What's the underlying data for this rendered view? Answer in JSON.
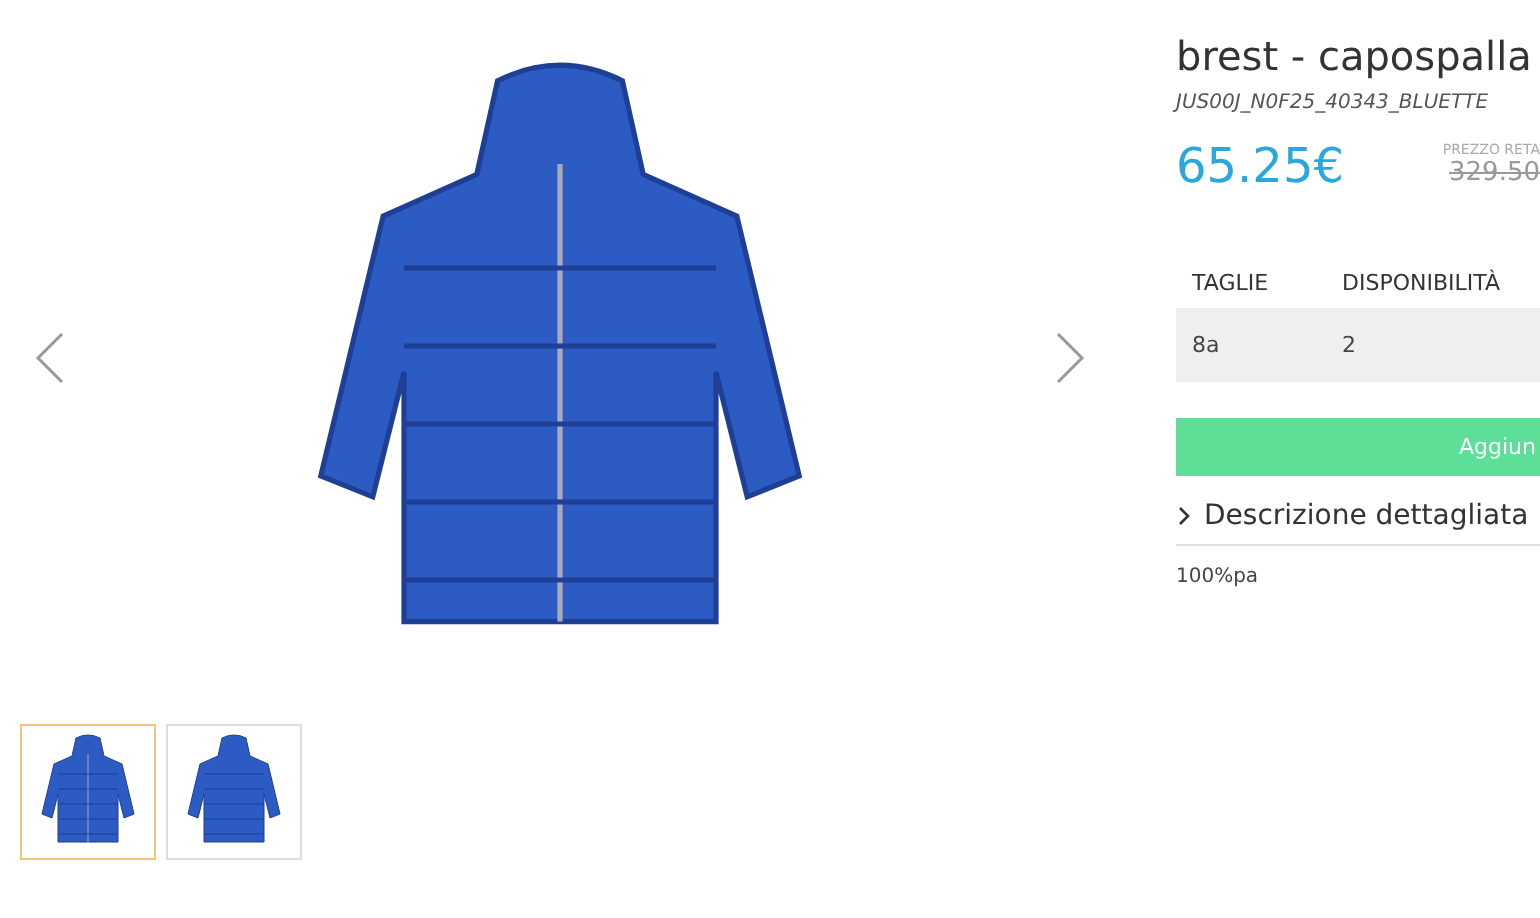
{
  "gallery": {
    "thumbnails": [
      {
        "selected": true
      },
      {
        "selected": false
      }
    ]
  },
  "product": {
    "title": "brest - capospalla",
    "code": "JUS00J_N0F25_40343_BLUETTE",
    "price": "65.25€",
    "retail_label": "PREZZO RETA",
    "retail_price": "329.50",
    "sizes": {
      "columns": [
        "TAGLIE",
        "DISPONIBILITÀ"
      ],
      "rows": [
        [
          "8a",
          "2"
        ]
      ]
    },
    "add_button": "Aggiun",
    "description": {
      "expanded": false,
      "title": "Descrizione dettagliata",
      "text": "100%pa"
    }
  }
}
